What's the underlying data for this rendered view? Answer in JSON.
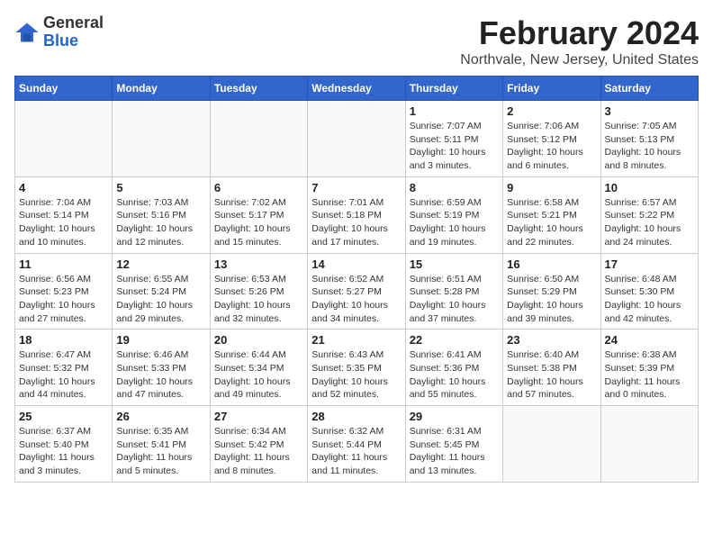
{
  "header": {
    "logo_general": "General",
    "logo_blue": "Blue",
    "month_title": "February 2024",
    "location": "Northvale, New Jersey, United States"
  },
  "days_of_week": [
    "Sunday",
    "Monday",
    "Tuesday",
    "Wednesday",
    "Thursday",
    "Friday",
    "Saturday"
  ],
  "weeks": [
    [
      {
        "day": "",
        "info": ""
      },
      {
        "day": "",
        "info": ""
      },
      {
        "day": "",
        "info": ""
      },
      {
        "day": "",
        "info": ""
      },
      {
        "day": "1",
        "info": "Sunrise: 7:07 AM\nSunset: 5:11 PM\nDaylight: 10 hours\nand 3 minutes."
      },
      {
        "day": "2",
        "info": "Sunrise: 7:06 AM\nSunset: 5:12 PM\nDaylight: 10 hours\nand 6 minutes."
      },
      {
        "day": "3",
        "info": "Sunrise: 7:05 AM\nSunset: 5:13 PM\nDaylight: 10 hours\nand 8 minutes."
      }
    ],
    [
      {
        "day": "4",
        "info": "Sunrise: 7:04 AM\nSunset: 5:14 PM\nDaylight: 10 hours\nand 10 minutes."
      },
      {
        "day": "5",
        "info": "Sunrise: 7:03 AM\nSunset: 5:16 PM\nDaylight: 10 hours\nand 12 minutes."
      },
      {
        "day": "6",
        "info": "Sunrise: 7:02 AM\nSunset: 5:17 PM\nDaylight: 10 hours\nand 15 minutes."
      },
      {
        "day": "7",
        "info": "Sunrise: 7:01 AM\nSunset: 5:18 PM\nDaylight: 10 hours\nand 17 minutes."
      },
      {
        "day": "8",
        "info": "Sunrise: 6:59 AM\nSunset: 5:19 PM\nDaylight: 10 hours\nand 19 minutes."
      },
      {
        "day": "9",
        "info": "Sunrise: 6:58 AM\nSunset: 5:21 PM\nDaylight: 10 hours\nand 22 minutes."
      },
      {
        "day": "10",
        "info": "Sunrise: 6:57 AM\nSunset: 5:22 PM\nDaylight: 10 hours\nand 24 minutes."
      }
    ],
    [
      {
        "day": "11",
        "info": "Sunrise: 6:56 AM\nSunset: 5:23 PM\nDaylight: 10 hours\nand 27 minutes."
      },
      {
        "day": "12",
        "info": "Sunrise: 6:55 AM\nSunset: 5:24 PM\nDaylight: 10 hours\nand 29 minutes."
      },
      {
        "day": "13",
        "info": "Sunrise: 6:53 AM\nSunset: 5:26 PM\nDaylight: 10 hours\nand 32 minutes."
      },
      {
        "day": "14",
        "info": "Sunrise: 6:52 AM\nSunset: 5:27 PM\nDaylight: 10 hours\nand 34 minutes."
      },
      {
        "day": "15",
        "info": "Sunrise: 6:51 AM\nSunset: 5:28 PM\nDaylight: 10 hours\nand 37 minutes."
      },
      {
        "day": "16",
        "info": "Sunrise: 6:50 AM\nSunset: 5:29 PM\nDaylight: 10 hours\nand 39 minutes."
      },
      {
        "day": "17",
        "info": "Sunrise: 6:48 AM\nSunset: 5:30 PM\nDaylight: 10 hours\nand 42 minutes."
      }
    ],
    [
      {
        "day": "18",
        "info": "Sunrise: 6:47 AM\nSunset: 5:32 PM\nDaylight: 10 hours\nand 44 minutes."
      },
      {
        "day": "19",
        "info": "Sunrise: 6:46 AM\nSunset: 5:33 PM\nDaylight: 10 hours\nand 47 minutes."
      },
      {
        "day": "20",
        "info": "Sunrise: 6:44 AM\nSunset: 5:34 PM\nDaylight: 10 hours\nand 49 minutes."
      },
      {
        "day": "21",
        "info": "Sunrise: 6:43 AM\nSunset: 5:35 PM\nDaylight: 10 hours\nand 52 minutes."
      },
      {
        "day": "22",
        "info": "Sunrise: 6:41 AM\nSunset: 5:36 PM\nDaylight: 10 hours\nand 55 minutes."
      },
      {
        "day": "23",
        "info": "Sunrise: 6:40 AM\nSunset: 5:38 PM\nDaylight: 10 hours\nand 57 minutes."
      },
      {
        "day": "24",
        "info": "Sunrise: 6:38 AM\nSunset: 5:39 PM\nDaylight: 11 hours\nand 0 minutes."
      }
    ],
    [
      {
        "day": "25",
        "info": "Sunrise: 6:37 AM\nSunset: 5:40 PM\nDaylight: 11 hours\nand 3 minutes."
      },
      {
        "day": "26",
        "info": "Sunrise: 6:35 AM\nSunset: 5:41 PM\nDaylight: 11 hours\nand 5 minutes."
      },
      {
        "day": "27",
        "info": "Sunrise: 6:34 AM\nSunset: 5:42 PM\nDaylight: 11 hours\nand 8 minutes."
      },
      {
        "day": "28",
        "info": "Sunrise: 6:32 AM\nSunset: 5:44 PM\nDaylight: 11 hours\nand 11 minutes."
      },
      {
        "day": "29",
        "info": "Sunrise: 6:31 AM\nSunset: 5:45 PM\nDaylight: 11 hours\nand 13 minutes."
      },
      {
        "day": "",
        "info": ""
      },
      {
        "day": "",
        "info": ""
      }
    ]
  ]
}
